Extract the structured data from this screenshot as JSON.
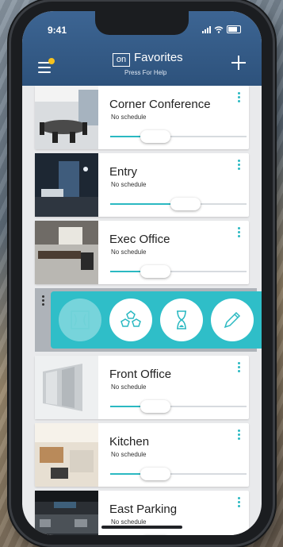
{
  "status": {
    "time": "9:41"
  },
  "header": {
    "logo_text": "on",
    "title": "Favorites",
    "subtitle": "Press For Help"
  },
  "accent_color": "#2bb9c2",
  "header_color": "#3a618f",
  "rooms": [
    {
      "name": "Corner Conference",
      "schedule": "No schedule",
      "level": 0.33
    },
    {
      "name": "Entry",
      "schedule": "No schedule",
      "level": 0.55
    },
    {
      "name": "Exec Office",
      "schedule": "No schedule",
      "level": 0.33
    }
  ],
  "action_menu": {
    "actions": [
      {
        "icon": "scene-icon",
        "active": true
      },
      {
        "icon": "group-icon",
        "active": false
      },
      {
        "icon": "hourglass-icon",
        "active": false
      },
      {
        "icon": "pencil-icon",
        "active": false
      }
    ]
  },
  "rooms_below": [
    {
      "name": "Front Office",
      "schedule": "No schedule",
      "level": 0.33
    },
    {
      "name": "Kitchen",
      "schedule": "No schedule",
      "level": 0.33
    },
    {
      "name": "East Parking",
      "schedule": "No schedule",
      "level": 0.33
    }
  ]
}
